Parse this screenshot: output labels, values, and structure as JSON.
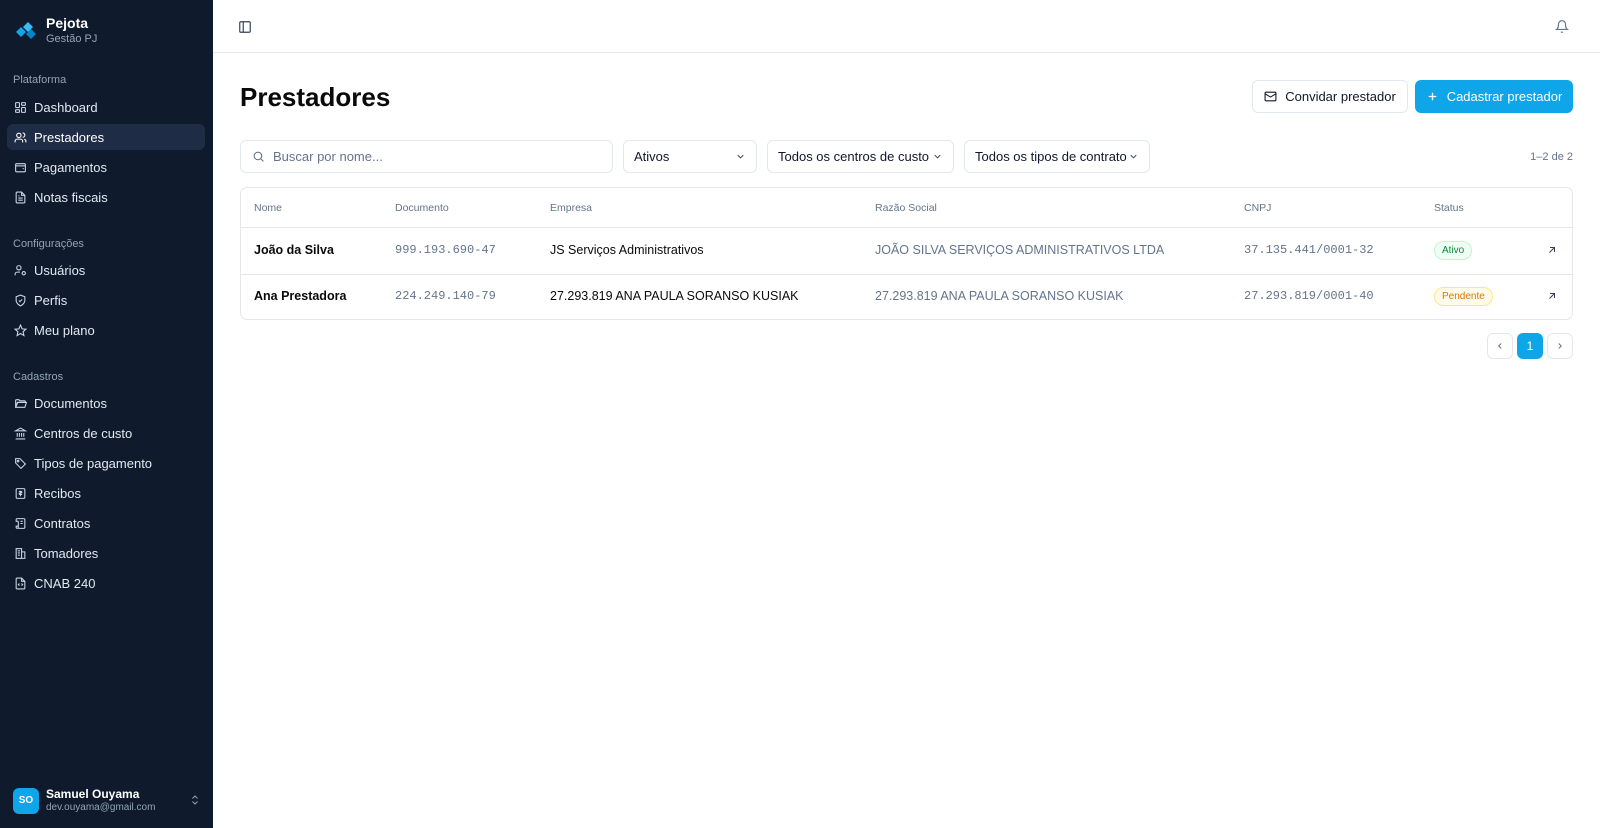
{
  "brand": {
    "name": "Pejota",
    "subtitle": "Gestão PJ",
    "accent": "#0ea5e9"
  },
  "sidebar": {
    "sections": [
      {
        "label": "Plataforma",
        "items": [
          {
            "label": "Dashboard",
            "icon": "dashboard-icon"
          },
          {
            "label": "Prestadores",
            "icon": "users-icon",
            "active": true
          },
          {
            "label": "Pagamentos",
            "icon": "wallet-icon"
          },
          {
            "label": "Notas fiscais",
            "icon": "file-text-icon"
          }
        ]
      },
      {
        "label": "Configurações",
        "items": [
          {
            "label": "Usuários",
            "icon": "user-cog-icon"
          },
          {
            "label": "Perfis",
            "icon": "shield-icon"
          },
          {
            "label": "Meu plano",
            "icon": "star-icon"
          }
        ]
      },
      {
        "label": "Cadastros",
        "items": [
          {
            "label": "Documentos",
            "icon": "folder-open-icon"
          },
          {
            "label": "Centros de custo",
            "icon": "landmark-icon"
          },
          {
            "label": "Tipos de pagamento",
            "icon": "tags-icon"
          },
          {
            "label": "Recibos",
            "icon": "receipt-icon"
          },
          {
            "label": "Contratos",
            "icon": "scroll-icon"
          },
          {
            "label": "Tomadores",
            "icon": "building-icon"
          },
          {
            "label": "CNAB 240",
            "icon": "file-code-icon"
          }
        ]
      }
    ],
    "user": {
      "initials": "SO",
      "name": "Samuel Ouyama",
      "email": "dev.ouyama@gmail.com"
    }
  },
  "page": {
    "title": "Prestadores",
    "invite_label": "Convidar prestador",
    "create_label": "Cadastrar prestador"
  },
  "filters": {
    "search_placeholder": "Buscar por nome...",
    "status": "Ativos",
    "cost_center": "Todos os centros de custo",
    "contract_type": "Todos os tipos de contrato",
    "count": "1–2 de 2"
  },
  "table": {
    "columns": [
      "Nome",
      "Documento",
      "Empresa",
      "Razão Social",
      "CNPJ",
      "Status"
    ],
    "rows": [
      {
        "nome": "João da Silva",
        "documento": "999.193.690-47",
        "empresa": "JS Serviços Administrativos",
        "razao_social": "JOÃO SILVA SERVIÇOS ADMINISTRATIVOS LTDA",
        "cnpj": "37.135.441/0001-32",
        "status": "Ativo",
        "status_color": "#15803d"
      },
      {
        "nome": "Ana Prestadora",
        "documento": "224.249.140-79",
        "empresa": "27.293.819 ANA PAULA SORANSO KUSIAK",
        "razao_social": "27.293.819 ANA PAULA SORANSO KUSIAK",
        "cnpj": "27.293.819/0001-40",
        "status": "Pendente",
        "status_color": "#d97706"
      }
    ]
  },
  "pagination": {
    "current_page": "1"
  }
}
